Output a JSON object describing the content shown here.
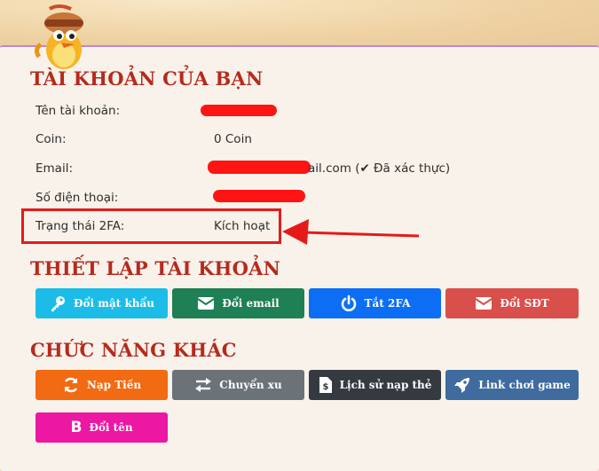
{
  "account": {
    "title": "TÀI KHOẢN CỦA BẠN",
    "rows": [
      {
        "label": "Tên tài khoản:",
        "value": ""
      },
      {
        "label": "Coin:",
        "value": "0 Coin"
      },
      {
        "label": "Email:",
        "value": "ail.com (✔ Đã xác thực)"
      },
      {
        "label": "Số điện thoại:",
        "value": ""
      },
      {
        "label": "Trạng thái 2FA:",
        "value": "Kích hoạt"
      }
    ]
  },
  "settings": {
    "title": "THIẾT LẬP TÀI KHOẢN",
    "buttons": [
      {
        "label": "Đổi mật khẩu",
        "icon": "key-icon",
        "color": "#1bbde8"
      },
      {
        "label": "Đổi email",
        "icon": "envelope-icon",
        "color": "#1f7f55"
      },
      {
        "label": "Tắt 2FA",
        "icon": "power-icon",
        "color": "#0c6ef5"
      },
      {
        "label": "Đổi SĐT",
        "icon": "envelope-icon",
        "color": "#d94f4b"
      }
    ]
  },
  "other": {
    "title": "CHỨC NĂNG KHÁC",
    "buttons": [
      {
        "label": "Nạp Tiền",
        "icon": "refresh-icon",
        "color": "#f26a11"
      },
      {
        "label": "Chuyển xu",
        "icon": "exchange-icon",
        "color": "#6b7278"
      },
      {
        "label": "Lịch sử nạp thẻ",
        "icon": "invoice-icon",
        "color": "#353a41"
      },
      {
        "label": "Link chơi game",
        "icon": "rocket-icon",
        "color": "#3f6b9e"
      },
      {
        "label": "Đổi tên",
        "icon": "bold-b-icon",
        "color": "#ec17a3"
      }
    ]
  },
  "annotation": {
    "color": "#e41a1a"
  }
}
